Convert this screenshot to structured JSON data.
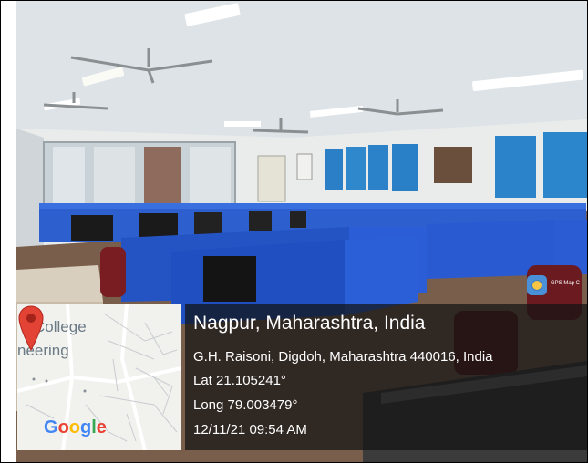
{
  "photo": {
    "description_icon": "computer-lab-photo"
  },
  "map": {
    "label_college": "College",
    "label_neering": "neering",
    "google_logo": "Google",
    "pin_icon": "map-pin-icon",
    "google_colors": [
      "#4285F4",
      "#EA4335",
      "#FBBC05",
      "#4285F4",
      "#34A853",
      "#EA4335"
    ]
  },
  "stamp": {
    "title": "Nagpur, Maharashtra, India",
    "address": "G.H. Raisoni, Digdoh, Maharashtra 440016, India",
    "lat": "Lat 21.105241°",
    "long": "Long 79.003479°",
    "datetime": "12/11/21 09:54 AM"
  },
  "app_badge": {
    "name": "GPS Map C",
    "icon": "gps-map-camera-icon"
  }
}
